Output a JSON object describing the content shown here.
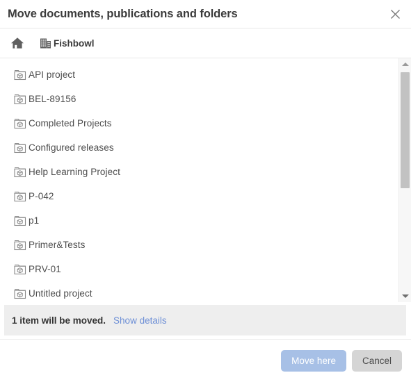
{
  "dialog": {
    "title": "Move documents, publications and folders",
    "close_icon": "close-icon"
  },
  "breadcrumb": {
    "home_icon": "home-icon",
    "items": [
      {
        "label": "Fishbowl",
        "icon": "building-icon"
      }
    ]
  },
  "list": {
    "item_icon": "project-folder-icon",
    "items": [
      {
        "label": "API project"
      },
      {
        "label": "BEL-89156"
      },
      {
        "label": "Completed Projects"
      },
      {
        "label": "Configured releases"
      },
      {
        "label": "Help Learning Project"
      },
      {
        "label": "P-042"
      },
      {
        "label": "p1"
      },
      {
        "label": "Primer&Tests"
      },
      {
        "label": "PRV-01"
      },
      {
        "label": "Untitled project"
      }
    ]
  },
  "scrollbar": {
    "up_icon": "chevron-up-icon",
    "down_icon": "chevron-down-icon"
  },
  "info": {
    "message": "1 item will be moved.",
    "details_link": "Show details"
  },
  "footer": {
    "primary_label": "Move here",
    "secondary_label": "Cancel"
  },
  "colors": {
    "primary_button": "#a7c0e6",
    "secondary_button": "#d5d5d5",
    "link": "#6d8fd6",
    "info_bar": "#eeeeee",
    "icon_gray": "#6e6e6e",
    "text": "#4d4d4d"
  }
}
